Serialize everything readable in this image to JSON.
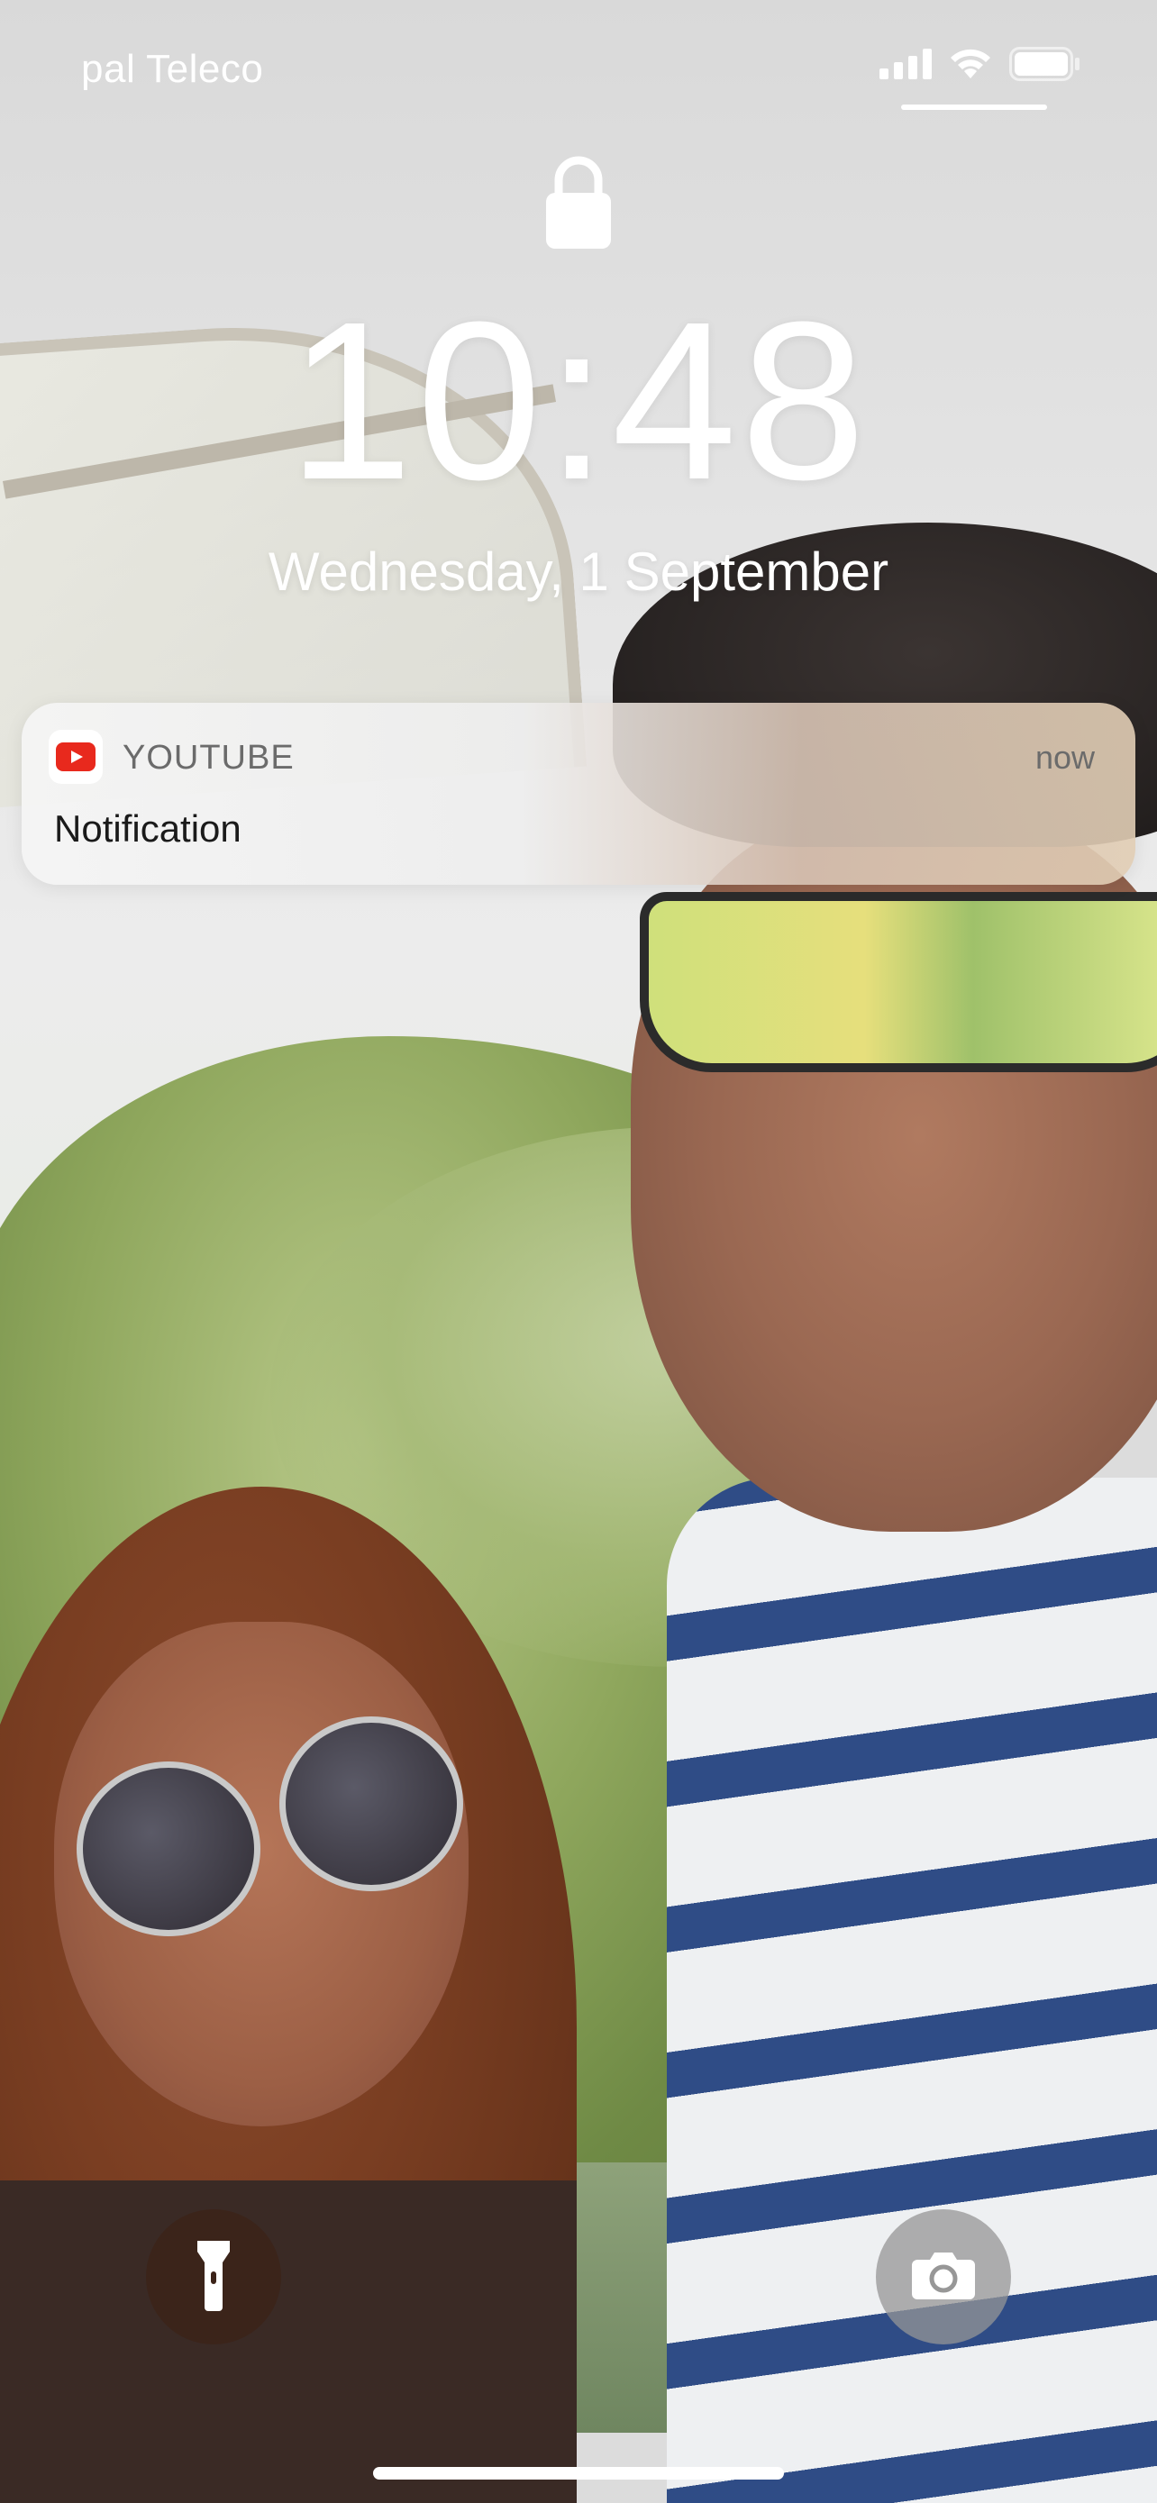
{
  "status_bar": {
    "carrier": "pal Teleco",
    "signal_icon": "cellular-signal-icon",
    "wifi_icon": "wifi-icon",
    "battery_icon": "battery-icon"
  },
  "lock_screen": {
    "lock_icon": "lock-icon",
    "time": "10:48",
    "date": "Wednesday, 1 September"
  },
  "notification": {
    "app_icon": "youtube-icon",
    "app_name": "YOUTUBE",
    "time": "now",
    "body": "Notification"
  },
  "quick_actions": {
    "flashlight_icon": "flashlight-icon",
    "camera_icon": "camera-icon"
  },
  "colors": {
    "youtube_red": "#e8291d",
    "text_white": "#ffffff"
  }
}
